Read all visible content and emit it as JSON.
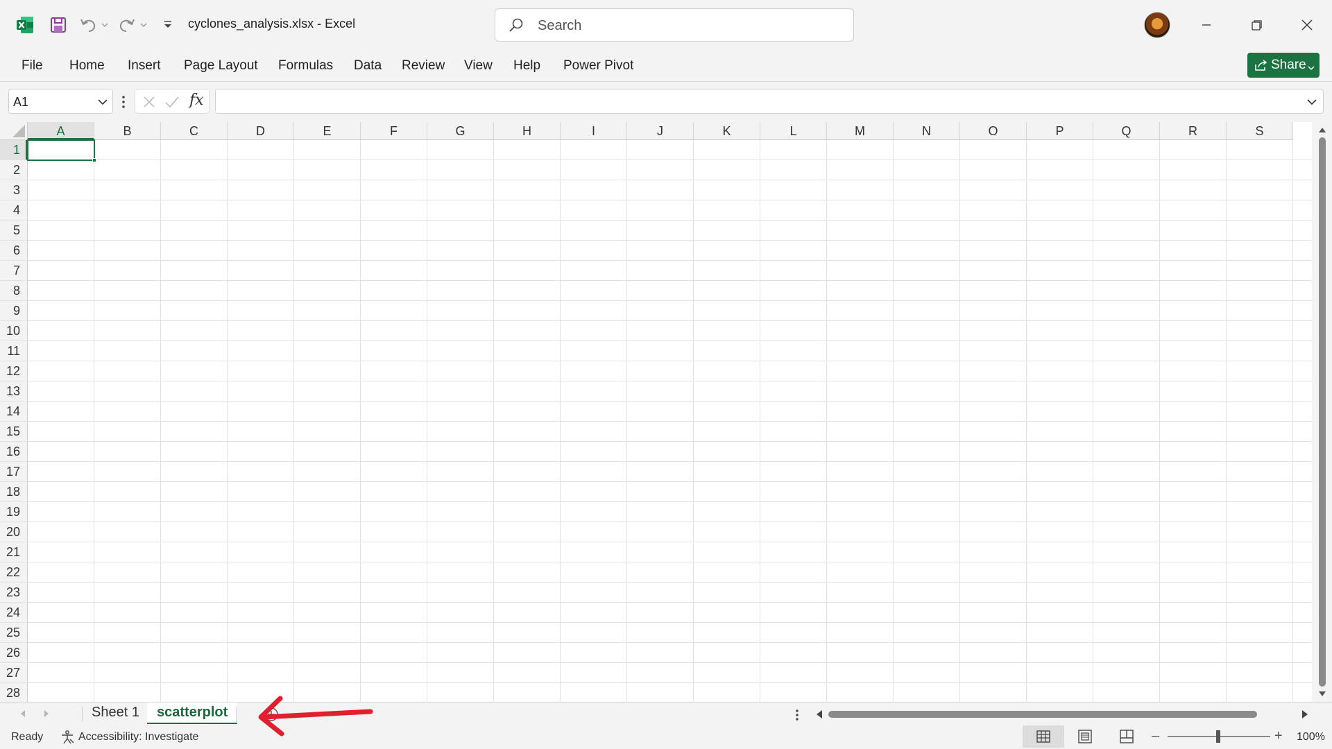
{
  "window": {
    "doc_title": "cyclones_analysis.xlsx  -  Excel"
  },
  "search": {
    "placeholder": "Search"
  },
  "menu": {
    "items": [
      "File",
      "Home",
      "Insert",
      "Page Layout",
      "Formulas",
      "Data",
      "Review",
      "View",
      "Help",
      "Power Pivot"
    ],
    "share_label": "Share"
  },
  "formula_bar": {
    "name_box": "A1",
    "fx": "fx",
    "value": ""
  },
  "grid": {
    "columns": [
      "A",
      "B",
      "C",
      "D",
      "E",
      "F",
      "G",
      "H",
      "I",
      "J",
      "K",
      "L",
      "M",
      "N",
      "O",
      "P",
      "Q",
      "R",
      "S"
    ],
    "rows": [
      "1",
      "2",
      "3",
      "4",
      "5",
      "6",
      "7",
      "8",
      "9",
      "10",
      "11",
      "12",
      "13",
      "14",
      "15",
      "16",
      "17",
      "18",
      "19",
      "20",
      "21",
      "22",
      "23",
      "24",
      "25",
      "26",
      "27",
      "28"
    ],
    "active_cell": "A1"
  },
  "sheets": {
    "tabs": [
      "Sheet 1",
      "scatterplot"
    ],
    "active": "scatterplot"
  },
  "status": {
    "ready": "Ready",
    "accessibility": "Accessibility: Investigate",
    "zoom": "100%",
    "zoom_minus": "–",
    "zoom_plus": "+"
  },
  "colors": {
    "accent": "#1a7340",
    "annotation": "#e0202e"
  }
}
